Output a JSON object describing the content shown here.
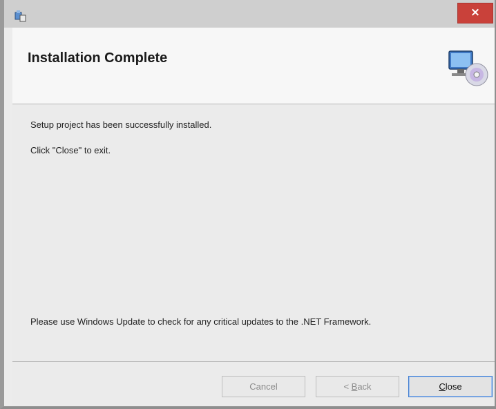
{
  "window": {
    "close_glyph": "×"
  },
  "header": {
    "title": "Installation Complete",
    "graphic_icon": "computer-disc-icon"
  },
  "content": {
    "line1": "Setup project has been successfully installed.",
    "line2": "Click \"Close\" to exit.",
    "line3": "Please use Windows Update to check for any critical updates to the .NET Framework."
  },
  "buttons": {
    "cancel_label": "Cancel",
    "back_mnemonic": "B",
    "back_rest": "ack",
    "back_prefix": "< ",
    "close_mnemonic": "C",
    "close_rest": "lose"
  },
  "colors": {
    "close_button": "#c9413a",
    "default_button_border": "#3d7bd1"
  }
}
